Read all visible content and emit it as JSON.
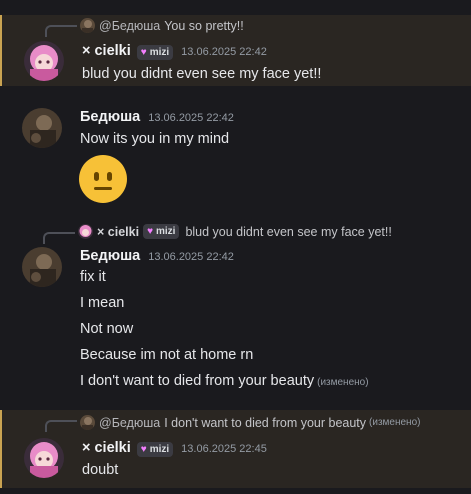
{
  "messages": [
    {
      "reply": {
        "author": "@Бедюша",
        "text": "You so pretty!!"
      },
      "author": "× cielki",
      "tag": "mizi",
      "timestamp": "13.06.2025 22:42",
      "lines": [
        "blud you didnt even see my face yet!!"
      ]
    },
    {
      "author": "Бедюша",
      "timestamp": "13.06.2025 22:42",
      "lines": [
        "Now its you in my mind"
      ],
      "emoji": "neutral-face-emoji"
    },
    {
      "reply": {
        "author": "× cielki",
        "tag": "mizi",
        "text": "blud you didnt even see my face yet!!"
      },
      "author": "Бедюша",
      "timestamp": "13.06.2025 22:42",
      "lines": [
        "fix it",
        "I mean",
        "Not now",
        "Because im not at home rn",
        "I don't want to died from your beauty"
      ],
      "edited": "(изменено)"
    },
    {
      "reply": {
        "author": "@Бедюша",
        "text": "I don't want to died from your beauty",
        "edited": "(изменено)"
      },
      "author": "× cielki",
      "tag": "mizi",
      "timestamp": "13.06.2025 22:45",
      "lines": [
        "doubt"
      ]
    }
  ],
  "colors": {
    "background": "#1a1a1e",
    "highlight": "#2a2622",
    "highlight_border": "#c9a352",
    "tag_heart": "#f47fff"
  }
}
